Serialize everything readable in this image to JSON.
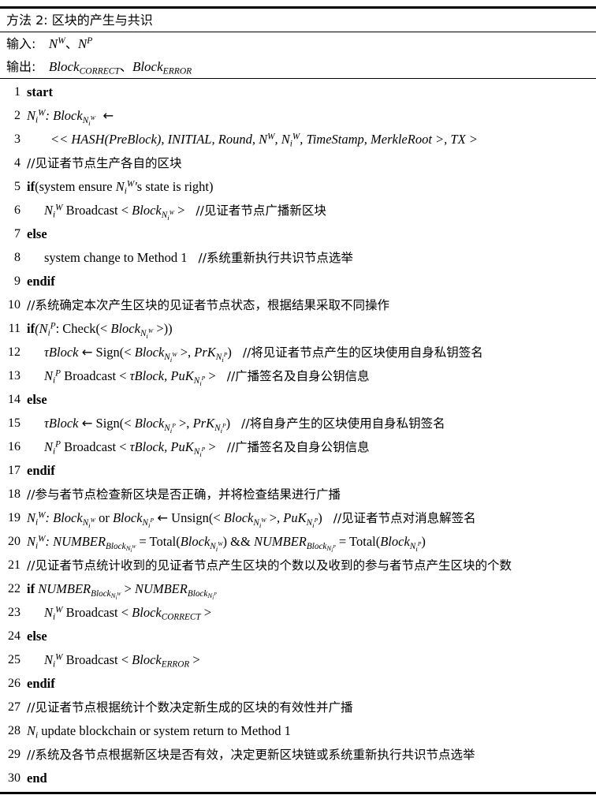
{
  "document": {
    "type": "algorithm-pseudocode",
    "title_label": "方法 2:",
    "title_text": "区块的产生与共识",
    "input_label": "输入:",
    "output_label": "输出:",
    "input_value": "N^W、N^P",
    "output_value": "Block_CORRECT、Block_ERROR"
  },
  "header": {
    "title": "方法 2: 区块的产生与共识",
    "input_row": "输入: N^W、N^P",
    "output_row": "输出: Block_CORRECT、Block_ERROR"
  },
  "lines": [
    {
      "n": "1",
      "text": "start"
    },
    {
      "n": "2",
      "text": "N_i^W : Block_{N_i^W} ←"
    },
    {
      "n": "3",
      "text": "<< HASH(PreBlock), INITIAL, Round, N^W, N_i^W, TimeStamp, MerkleRoot >, TX >"
    },
    {
      "n": "4",
      "text": "//见证者节点生产各自的区块"
    },
    {
      "n": "5",
      "text": "if(system ensure N_i^W's state is right)"
    },
    {
      "n": "6",
      "text": "N_i^W Broadcast < Block_{N_i^W} >   //见证者节点广播新区块"
    },
    {
      "n": "7",
      "text": "else"
    },
    {
      "n": "8",
      "text": "system change to Method 1   //系统重新执行共识节点选举"
    },
    {
      "n": "9",
      "text": "endif"
    },
    {
      "n": "10",
      "text": "//系统确定本次产生区块的见证者节点状态，根据结果采取不同操作"
    },
    {
      "n": "11",
      "text": "if(N_i^P : Check(< Block_{N_i^W} >))"
    },
    {
      "n": "12",
      "text": "τBlock ← Sign(< Block_{N_i^W} >, PrK_{N_i^P})   //将见证者节点产生的区块使用自身私钥签名"
    },
    {
      "n": "13",
      "text": "N_i^P Broadcast < τBlock, PuK_{N_i^P} >   //广播签名及自身公钥信息"
    },
    {
      "n": "14",
      "text": "else"
    },
    {
      "n": "15",
      "text": "τBlock ← Sign(< Block_{N_i^P} >, PrK_{N_i^P})   //将自身产生的区块使用自身私钥签名"
    },
    {
      "n": "16",
      "text": "N_i^P Broadcast < τBlock, PuK_{N_i^P} >   //广播签名及自身公钥信息"
    },
    {
      "n": "17",
      "text": "endif"
    },
    {
      "n": "18",
      "text": "//参与者节点检查新区块是否正确，并将检查结果进行广播"
    },
    {
      "n": "19",
      "text": "N_i^W : Block_{N_i^W} or Block_{N_i^P} ← Unsign(< Block_{N_i^W} >, PuK_{N_i^P})   //见证者节点对消息解签名"
    },
    {
      "n": "20",
      "text": "N_i^W : NUMBER_{Block_{N_i^W}} = Total(Block_{N_i^W}) && NUMBER_{Block_{N_i^P}} = Total(Block_{N_i^P})"
    },
    {
      "n": "21",
      "text": "//见证者节点统计收到的见证者节点产生区块的个数以及收到的参与者节点产生区块的个数"
    },
    {
      "n": "22",
      "text": "if NUMBER_{Block_{N_i^W}} > NUMBER_{Block_{N_i^P}}"
    },
    {
      "n": "23",
      "text": "N_i^W Broadcast < Block_CORRECT >"
    },
    {
      "n": "24",
      "text": "else"
    },
    {
      "n": "25",
      "text": "N_i^W Broadcast < Block_ERROR >"
    },
    {
      "n": "26",
      "text": "endif"
    },
    {
      "n": "27",
      "text": "//见证者节点根据统计个数决定新生成的区块的有效性并广播"
    },
    {
      "n": "28",
      "text": "N_i update blockchain or system return to Method 1"
    },
    {
      "n": "29",
      "text": "//系统及各节点根据新区块是否有效，决定更新区块链或系统重新执行共识节点选举"
    },
    {
      "n": "30",
      "text": "end"
    }
  ],
  "comments": {
    "c4": "//见证者节点生产各自的区块",
    "c6": "//见证者节点广播新区块",
    "c8": "//系统重新执行共识节点选举",
    "c10": "//系统确定本次产生区块的见证者节点状态，根据结果采取不同操作",
    "c12": "//将见证者节点产生的区块使用自身私钥签名",
    "c13": "//广播签名及自身公钥信息",
    "c15": "//将自身产生的区块使用自身私钥签名",
    "c16": "//广播签名及自身公钥信息",
    "c18": "//参与者节点检查新区块是否正确，并将检查结果进行广播",
    "c19": "//见证者节点对消息解签名",
    "c21": "//见证者节点统计收到的见证者节点产生区块的个数以及收到的参与者节点产生区块的个数",
    "c27": "//见证者节点根据统计个数决定新生成的区块的有效性并广播",
    "c29": "//系统及各节点根据新区块是否有效，决定更新区块链或系统重新执行共识节点选举"
  },
  "keywords": {
    "start": "start",
    "if": "if",
    "else": "else",
    "endif": "endif",
    "end": "end"
  },
  "symbols": {
    "arrow": "←",
    "enum": "、",
    "lt": "<",
    "gt": ">",
    "tau": "τ"
  },
  "colors": {
    "text": "#000000",
    "background": "#ffffff",
    "rule": "#000000"
  }
}
